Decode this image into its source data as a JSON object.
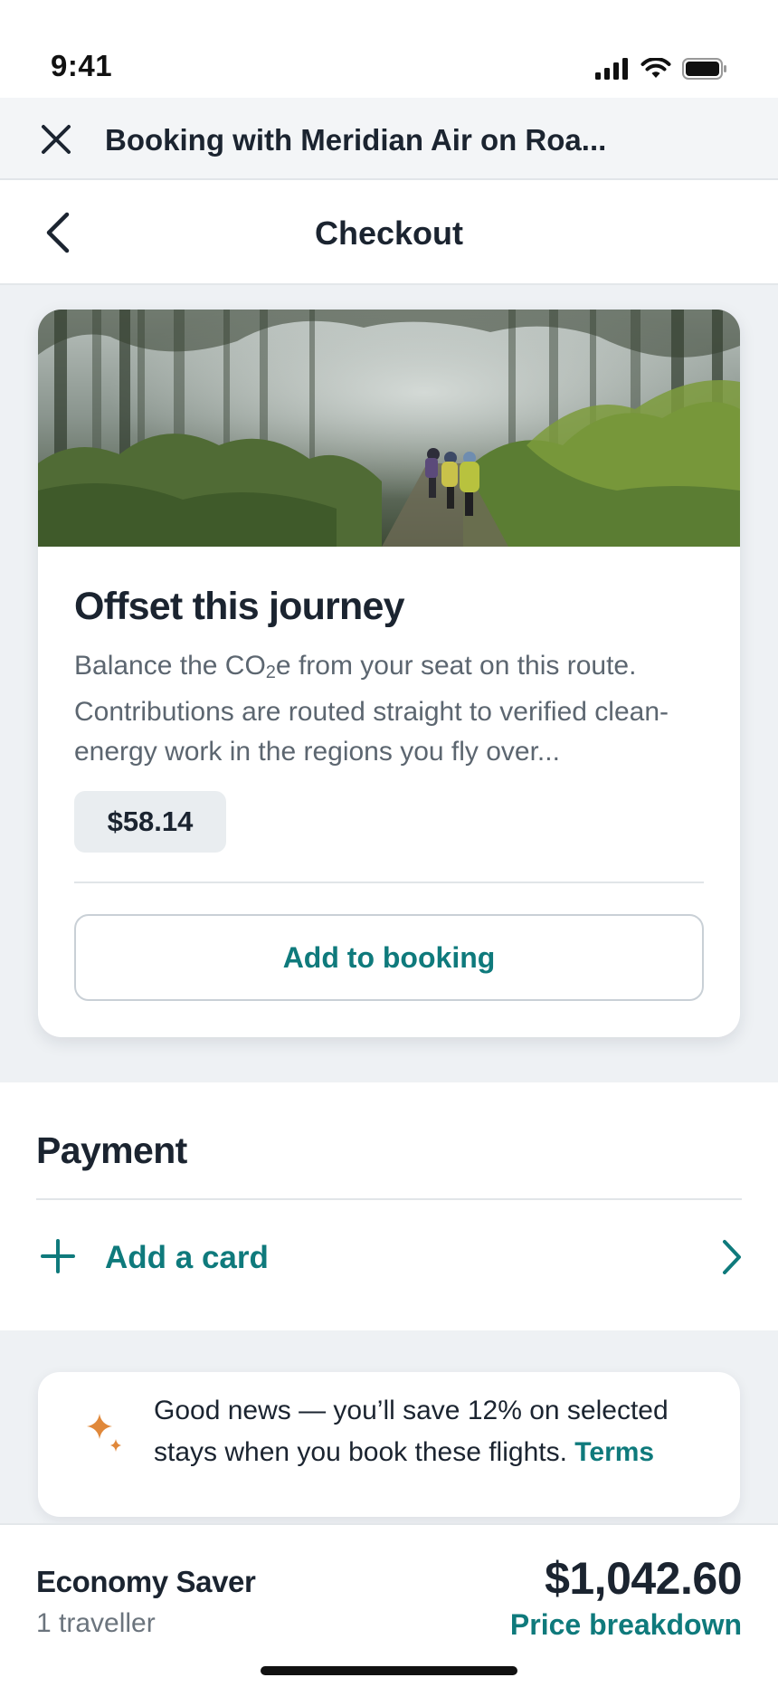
{
  "status_bar": {
    "time": "9:41",
    "icons": [
      "cellular-signal-icon",
      "wifi-icon",
      "battery-icon"
    ]
  },
  "browser_bar": {
    "close_icon": "close-icon",
    "title": "Booking with Meridian Air on Roa..."
  },
  "nav_bar": {
    "back_icon": "chevron-left-icon",
    "title": "Checkout"
  },
  "offset_card": {
    "image": "forest-hikers-photo",
    "title": "Offset this journey",
    "description_before_sub": "Balance the CO",
    "description_sub": "2",
    "description_after_sub": "e from your seat on this route. Contributions are routed straight to verified clean-energy work in the regions you fly over...",
    "price": "$58.14",
    "add_button_label": "Add to booking"
  },
  "payment": {
    "title": "Payment",
    "add_card_icon": "plus-icon",
    "add_card_label": "Add a card",
    "chevron_icon": "chevron-right-icon"
  },
  "news_banner": {
    "icon": "sparkle-icon",
    "text": "Good news — you’ll save 12% on selected stays when you book these flights.",
    "link_label": "Terms"
  },
  "bottom_bar": {
    "fare_name": "Economy Saver",
    "travellers": "1 traveller",
    "total_price": "$1,042.60",
    "breakdown_label": "Price breakdown"
  },
  "colors": {
    "accent": "#0f7a7c",
    "text_primary": "#1b2430",
    "text_secondary": "#5c6670",
    "background": "#eef1f4",
    "sparkle": "#e0883a"
  }
}
